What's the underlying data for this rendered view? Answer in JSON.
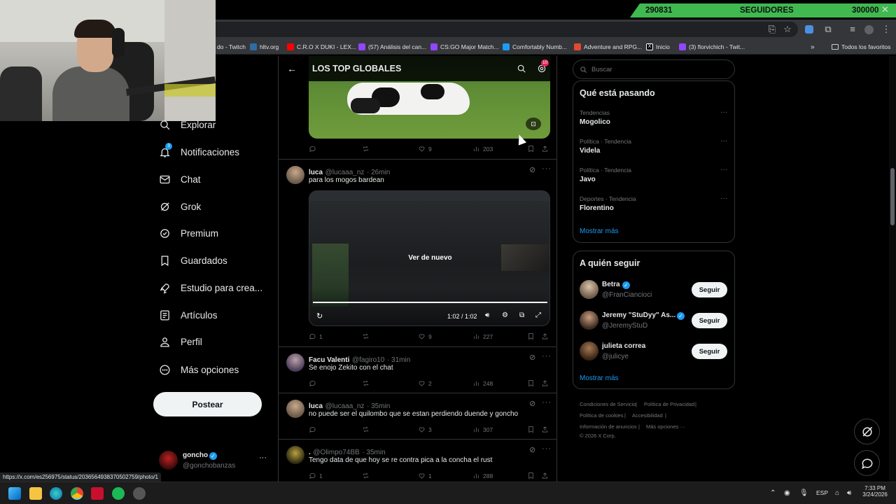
{
  "goal": {
    "current": "290831",
    "label": "SEGUIDORES",
    "target": "300000"
  },
  "bookmarks": [
    {
      "label": "do - Twitch",
      "color": "#9146ff"
    },
    {
      "label": "hltv.org",
      "color": "#2d6da3"
    },
    {
      "label": "C.R.O X DUKI - LEX...",
      "color": "#ff0000"
    },
    {
      "label": "(57) Análisis del can...",
      "color": "#9146ff"
    },
    {
      "label": "CS:GO Major Match...",
      "color": "#9146ff"
    },
    {
      "label": "Comfortably Numb...",
      "color": "#1d9bf0"
    },
    {
      "label": "Adventure and RPG...",
      "color": "#e2492f"
    },
    {
      "label": "Inicio",
      "color": "#ffffff"
    },
    {
      "label": "(3) florvichich - Twit...",
      "color": "#9146ff"
    }
  ],
  "bookmarks_all": "Todos los favoritos",
  "nav": {
    "notif_count": "3",
    "items": [
      {
        "label": "Explorar",
        "icon": "search-icon"
      },
      {
        "label": "Notificaciones",
        "icon": "bell-icon"
      },
      {
        "label": "Chat",
        "icon": "mail-icon"
      },
      {
        "label": "Grok",
        "icon": "grok-icon"
      },
      {
        "label": "Premium",
        "icon": "verified-icon"
      },
      {
        "label": "Guardados",
        "icon": "bookmark-icon"
      },
      {
        "label": "Estudio para crea...",
        "icon": "rocket-icon"
      },
      {
        "label": "Artículos",
        "icon": "article-icon"
      },
      {
        "label": "Perfil",
        "icon": "person-icon"
      },
      {
        "label": "Más opciones",
        "icon": "more-circle-icon"
      }
    ],
    "post_label": "Postear"
  },
  "account": {
    "name": "goncho",
    "handle": "@gonchobanzas"
  },
  "timeline": {
    "title": "LOS TOP GLOBALES",
    "badge": "10",
    "tweets": [
      {
        "replies": "",
        "retweets": "",
        "likes": "9",
        "views": "203"
      },
      {
        "name": "luca",
        "handle": "@lucaaa_nz",
        "time": "· 26min",
        "text": "para los mogos bardean",
        "video": {
          "overlay": "Ver de nuevo",
          "time": "1:02 / 1:02"
        },
        "replies": "1",
        "retweets": "",
        "likes": "9",
        "views": "227"
      },
      {
        "name": "Facu Valenti",
        "handle": "@fagiro10",
        "time": "· 31min",
        "text": "Se enojo Zekito con el chat",
        "replies": "",
        "retweets": "",
        "likes": "2",
        "views": "248"
      },
      {
        "name": "luca",
        "handle": "@lucaaa_nz",
        "time": "· 35min",
        "text": "no puede ser el quilombo que se estan perdiendo duende y goncho",
        "replies": "",
        "retweets": "",
        "likes": "3",
        "views": "307"
      },
      {
        "name": ".",
        "handle": "@Olimpo74BB",
        "time": "· 35min",
        "text": "Tengo data de que hoy se re contra pica a la concha el rust",
        "replies": "1",
        "retweets": "",
        "likes": "1",
        "views": "288"
      }
    ]
  },
  "search": {
    "placeholder": "Buscar"
  },
  "trends": {
    "title": "Qué está pasando",
    "items": [
      {
        "category": "Tendencias",
        "name": "Mogolico"
      },
      {
        "category": "Política · Tendencia",
        "name": "Videla"
      },
      {
        "category": "Política · Tendencia",
        "name": "Javo"
      },
      {
        "category": "Deportes · Tendencia",
        "name": "Florentino"
      }
    ],
    "show_more": "Mostrar más"
  },
  "follow": {
    "title": "A quién seguir",
    "items": [
      {
        "name": "Betra",
        "handle": "@FranCiancioci",
        "button": "Seguir"
      },
      {
        "name": "Jeremy \"StuDyy\" As...",
        "handle": "@JeremyStuD",
        "button": "Seguir"
      },
      {
        "name": "julieta correa",
        "handle": "@julicye",
        "button": "Seguir"
      }
    ],
    "show_more": "Mostrar más"
  },
  "footer": {
    "links": [
      "Condiciones de Servicio",
      "Política de Privacidad",
      "Política de cookies",
      "Accesibilidad",
      "Información de anuncios",
      "Más opciones ···"
    ],
    "copyright": "© 2026 X Corp."
  },
  "status_url": "https://x.com/es256975/status/2036564938370502759/photo/1",
  "taskbar": {
    "lang": "ESP",
    "time": "7:33 PM",
    "date": "3/24/2026"
  },
  "colors": {
    "accent": "#1d9bf0",
    "goal_bar": "#3fb950",
    "background": "#000000"
  }
}
